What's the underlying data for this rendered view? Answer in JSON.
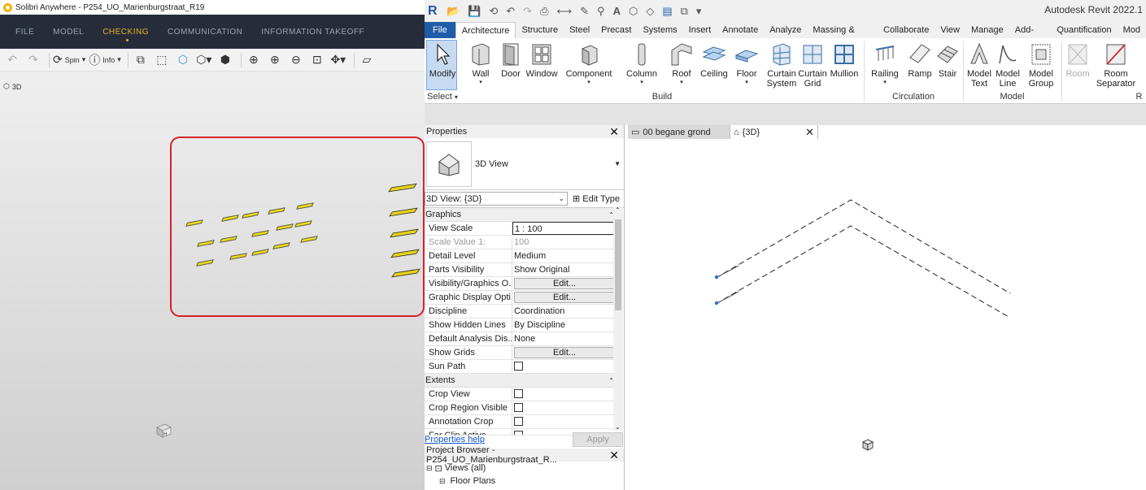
{
  "solibri": {
    "title": "Solibri Anywhere - P254_UO_Marienburgstraat_R19",
    "menus": [
      "FILE",
      "MODEL",
      "CHECKING",
      "COMMUNICATION",
      "INFORMATION TAKEOFF"
    ],
    "active_menu": "CHECKING",
    "toolbar": {
      "spin_label": "Spin",
      "info_label": "Info"
    },
    "view_label": "3D",
    "colors": {
      "menubar_bg": "#262c3a",
      "active_menu": "#e6b422",
      "highlight_box": "#d8202a",
      "model_elements": "#ecdc1a"
    }
  },
  "revit": {
    "title": "Autodesk Revit 2022.1",
    "tabs": [
      "File",
      "Architecture",
      "Structure",
      "Steel",
      "Precast",
      "Systems",
      "Insert",
      "Annotate",
      "Analyze",
      "Massing & Site",
      "Collaborate",
      "View",
      "Manage",
      "Add-Ins",
      "Quantification",
      "Mod"
    ],
    "active_tab": "Architecture",
    "ribbon": {
      "modify": "Modify",
      "wall": "Wall",
      "door": "Door",
      "window": "Window",
      "component": "Component",
      "column": "Column",
      "roof": "Roof",
      "ceiling": "Ceiling",
      "floor": "Floor",
      "curtain_system_1": "Curtain",
      "curtain_system_2": "System",
      "curtain_grid_1": "Curtain",
      "curtain_grid_2": "Grid",
      "mullion": "Mullion",
      "railing": "Railing",
      "ramp": "Ramp",
      "stair": "Stair",
      "model_text_1": "Model",
      "model_text_2": "Text",
      "model_line_1": "Model",
      "model_line_2": "Line",
      "model_group_1": "Model",
      "model_group_2": "Group",
      "room": "Room",
      "room_sep_1": "Room",
      "room_sep_2": "Separator",
      "group_select": "Select",
      "group_build": "Build",
      "group_circulation": "Circulation",
      "group_model": "Model",
      "group_r": "R"
    },
    "properties": {
      "title": "Properties",
      "type_name": "3D View",
      "instance_selector": "3D View: {3D}",
      "edit_type": "Edit Type",
      "graphics_header": "Graphics",
      "extents_header": "Extents",
      "rows": {
        "view_scale": {
          "k": "View Scale",
          "v": "1 : 100"
        },
        "scale_value": {
          "k": "Scale Value    1:",
          "v": "100"
        },
        "detail_level": {
          "k": "Detail Level",
          "v": "Medium"
        },
        "parts_visibility": {
          "k": "Parts Visibility",
          "v": "Show Original"
        },
        "vg_overrides": {
          "k": "Visibility/Graphics O...",
          "v": "Edit..."
        },
        "graphic_display": {
          "k": "Graphic Display Opti...",
          "v": "Edit..."
        },
        "discipline": {
          "k": "Discipline",
          "v": "Coordination"
        },
        "hidden_lines": {
          "k": "Show Hidden Lines",
          "v": "By Discipline"
        },
        "analysis_display": {
          "k": "Default Analysis Dis...",
          "v": "None"
        },
        "show_grids": {
          "k": "Show Grids",
          "v": "Edit..."
        },
        "sun_path": {
          "k": "Sun Path"
        },
        "crop_view": {
          "k": "Crop View"
        },
        "crop_region_visible": {
          "k": "Crop Region Visible"
        },
        "annotation_crop": {
          "k": "Annotation Crop"
        },
        "far_clip": {
          "k": "Far Clip Active"
        }
      },
      "help_link": "Properties help",
      "apply": "Apply"
    },
    "browser": {
      "title": "Project Browser - P254_UO_Marienburgstraat_R...",
      "items": [
        "Views (all)",
        "Floor Plans"
      ]
    },
    "view_tabs": [
      "00 begane grond",
      "{3D}"
    ],
    "active_view_tab": "{3D}",
    "colors": {
      "file_tab": "#1e5da8",
      "modify_active": "#c6daf2",
      "link": "#1155cc"
    }
  }
}
